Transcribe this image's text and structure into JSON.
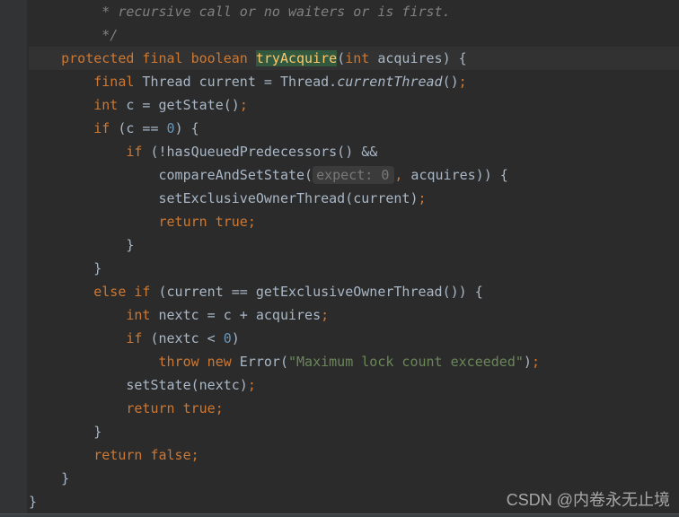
{
  "lines": {
    "l1_comment": " * recursive call or no waiters or is first.",
    "l2_comment": " */",
    "l3": {
      "mods": "protected final boolean",
      "name": "tryAcquire",
      "params_open": "(",
      "ptype": "int",
      "pname": " acquires) {"
    },
    "l4": {
      "kw": "final",
      "rest1": " Thread current = Thread.",
      "ital": "currentThread",
      "rest2": "()",
      "semi": ";"
    },
    "l5": {
      "kw": "int",
      "rest": " c = getState()",
      "semi": ";"
    },
    "l6": {
      "kw": "if",
      "rest1": " (c == ",
      "num": "0",
      "rest2": ") {"
    },
    "l7": {
      "kw": "if",
      "rest": " (!hasQueuedPredecessors() &&"
    },
    "l8": {
      "rest1": "compareAndSetState(",
      "hint_label": "expect:",
      "hint_val": " 0",
      "comma": ",",
      "rest2": " acquires)) {"
    },
    "l9": {
      "rest": "setExclusiveOwnerThread(current)",
      "semi": ";"
    },
    "l10": {
      "kw": "return true",
      "semi": ";"
    },
    "l11": "}",
    "l12": "}",
    "l13": {
      "kw1": "else if",
      "rest": " (current == getExclusiveOwnerThread()) {"
    },
    "l14": {
      "kw": "int",
      "rest": " nextc = c + acquires",
      "semi": ";"
    },
    "l15": {
      "kw": "if",
      "rest1": " (nextc < ",
      "num": "0",
      "rest2": ")"
    },
    "l16": {
      "kw": "throw new",
      "rest1": " Error(",
      "str": "\"Maximum lock count exceeded\"",
      "rest2": ")",
      "semi": ";"
    },
    "l17": {
      "rest": "setState(nextc)",
      "semi": ";"
    },
    "l18": {
      "kw": "return true",
      "semi": ";"
    },
    "l19": "}",
    "l20": {
      "kw": "return false",
      "semi": ";"
    },
    "l21": "}",
    "l22": "}"
  },
  "watermark": "CSDN @内卷永无止境"
}
